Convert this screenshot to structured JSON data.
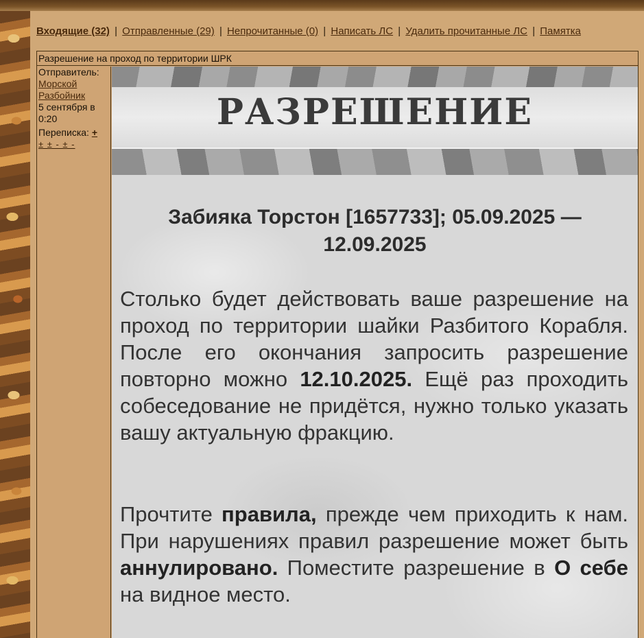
{
  "nav": {
    "inbox": "Входящие (32)",
    "sent": "Отправленные (29)",
    "unread": "Непрочитанные (0)",
    "write": "Написать ЛС",
    "delete_read": "Удалить прочитанные ЛС",
    "memo": "Памятка",
    "separator": "|"
  },
  "message": {
    "subject": "Разрешение на проход по территории ШРК",
    "sender_label": "Отправитель:",
    "sender_name_line1": "Морской",
    "sender_name_line2": "Разбойник",
    "date_line1": "5 сентября в",
    "date_line2": "0:20",
    "thread_label": "Переписка:",
    "thread_plus": "+",
    "thread_links": "± ± - ± -"
  },
  "content": {
    "banner_title": "РАЗРЕШЕНИЕ",
    "heading": "Забияка Торстон [1657733]; 05.09.2025 — 12.09.2025",
    "p1_text1": "Столько будет действовать ваше разрешение на проход по территории шайки Разбитого Корабля. После его окончания запросить разрешение повторно можно ",
    "p1_bold": "12.10.2025.",
    "p1_text2": " Ещё раз проходить собеседование не придётся, нужно только указать вашу актуальную фракцию.",
    "p2_text1": "Прочтите ",
    "p2_bold1": "правила,",
    "p2_text2": " прежде чем приходить к нам. При нарушениях правил разрешение может быть ",
    "p2_bold2": "аннулировано.",
    "p2_text3": " Поместите разрешение в ",
    "p2_bold3": "О себе",
    "p2_text4": " на видное место."
  }
}
